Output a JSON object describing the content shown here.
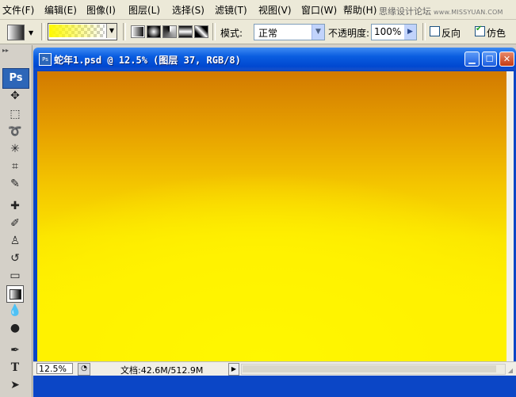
{
  "menu": [
    "文件(F)",
    "编辑(E)",
    "图像(I)",
    "图层(L)",
    "选择(S)",
    "滤镜(T)",
    "视图(V)",
    "窗口(W)",
    "帮助(H)"
  ],
  "watermark": {
    "text": "思缘设计论坛",
    "url": "www.MISSYUAN.COM"
  },
  "options": {
    "mode_label": "模式:",
    "mode_value": "正常",
    "opacity_label": "不透明度:",
    "opacity_value": "100%",
    "reverse_label": "反向",
    "reverse_checked": false,
    "dither_label": "仿色",
    "dither_checked": true,
    "gradient_color": "#fff800"
  },
  "toolbox": {
    "logo": "Ps",
    "active_tool": "gradient-tool",
    "tools": [
      "move-tool",
      "marquee-tool",
      "lasso-tool",
      "magic-wand-tool",
      "crop-tool",
      "slice-tool",
      "healing-brush-tool",
      "brush-tool",
      "clone-stamp-tool",
      "history-brush-tool",
      "eraser-tool",
      "gradient-tool",
      "blur-tool",
      "dodge-tool",
      "pen-tool",
      "type-tool",
      "path-selection-tool"
    ]
  },
  "document": {
    "title": "蛇年1.psd @ 12.5% (图层 37, RGB/8)",
    "zoom": "12.5%",
    "doc_info": "文档:42.6M/512.9M",
    "canvas_colors": {
      "top": "#d27a00",
      "mid": "#f4c600",
      "bottom": "#fff200"
    }
  }
}
